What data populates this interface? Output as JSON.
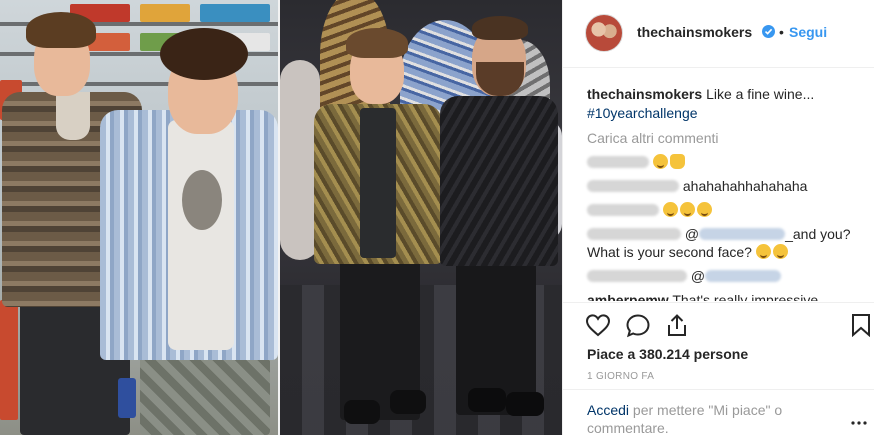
{
  "post": {
    "username": "thechainsmokers",
    "follow_label": "Segui",
    "separator": "•",
    "caption_text": "Like a fine wine...",
    "hashtag": "#10yearchallenge",
    "load_more": "Carica altri commenti",
    "comments": [
      {
        "text": "ahahahahhahahaha"
      },
      {
        "mention_suffix": "_and you?",
        "text_line2": "What is your second face?"
      },
      {
        "at": "@"
      },
      {
        "username": "amberpemw",
        "text": "That's really impressive"
      }
    ],
    "likes": "Piace a 380.214 persone",
    "time": "1 GIORNO FA",
    "login_link": "Accedi",
    "login_rest": "per mettere \"Mi piace\" o commentare."
  },
  "icons": {
    "verified": "verified-badge-icon",
    "like": "heart-outline-icon",
    "comment": "speech-bubble-icon",
    "share": "share-upload-icon",
    "save": "bookmark-icon",
    "more": "more-options-icon"
  },
  "colors": {
    "link_blue": "#3897f0",
    "hashtag_blue": "#003569",
    "muted_gray": "#999999",
    "text": "#262626",
    "border": "#efefef"
  }
}
